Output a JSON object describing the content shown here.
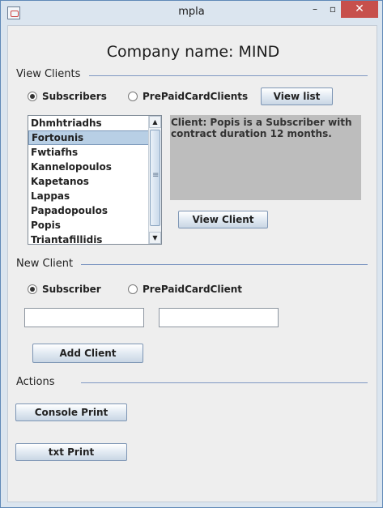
{
  "window": {
    "title": "mpla",
    "minimize_glyph": "–",
    "maximize_glyph": "▫",
    "close_glyph": "✕"
  },
  "company_heading": "Company name: MIND",
  "view_clients": {
    "section_label": "View Clients",
    "radio_subscribers": "Subscribers",
    "radio_prepaid": "PrePaidCardClients",
    "view_list_button": "View list",
    "clients": [
      "Dhmhtriadhs",
      "Fortounis",
      "Fwtiafhs",
      "Kannelopoulos",
      "Kapetanos",
      "Lappas",
      "Papadopoulos",
      "Popis",
      "Triantafillidis"
    ],
    "selected_client": "Fortounis",
    "info_text": "Client: Popis is a Subscriber with contract duration 12 months.",
    "view_client_button": "View Client"
  },
  "new_client": {
    "section_label": "New Client",
    "radio_subscriber": "Subscriber",
    "radio_prepaid": "PrePaidCardClient",
    "field_one_value": "",
    "field_two_value": "",
    "add_client_button": "Add Client"
  },
  "actions": {
    "section_label": "Actions",
    "console_print_button": "Console Print",
    "txt_print_button": "txt Print"
  }
}
